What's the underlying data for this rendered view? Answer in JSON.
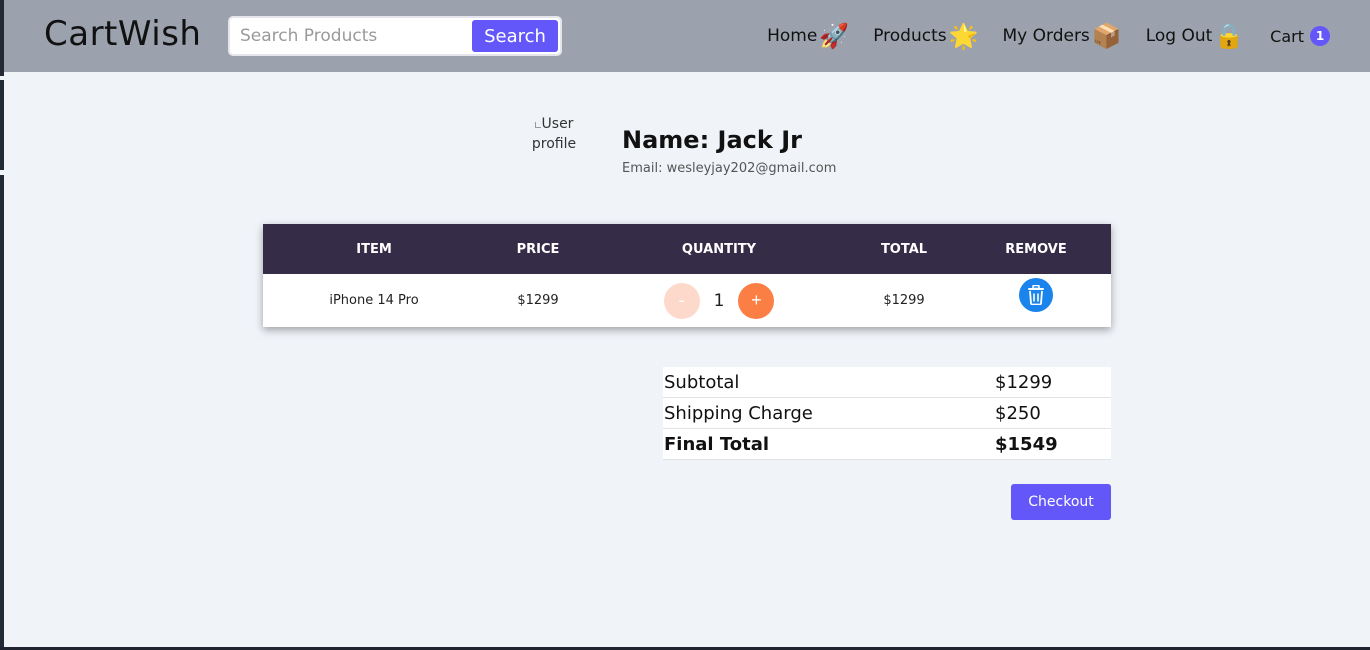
{
  "brand": "CartWish",
  "search": {
    "placeholder": "Search Products",
    "button_label": "Search"
  },
  "nav": {
    "home": "Home",
    "home_icon": "🚀",
    "products": "Products",
    "products_icon": "🌟",
    "orders": "My Orders",
    "orders_icon": "📦",
    "logout": "Log Out",
    "logout_icon": "🔒",
    "cart": "Cart",
    "cart_count": "1"
  },
  "profile": {
    "avatar_alt": "User profile",
    "name": "Name: Jack Jr",
    "email": "Email: wesleyjay202@gmail.com"
  },
  "table": {
    "headers": [
      "ITEM",
      "PRICE",
      "QUANTITY",
      "TOTAL",
      "REMOVE"
    ],
    "rows": [
      {
        "item": "iPhone 14 Pro",
        "price": "$1299",
        "quantity": "1",
        "total": "$1299",
        "minus": "-",
        "plus": "+"
      }
    ]
  },
  "summary": {
    "subtotal_label": "Subtotal",
    "subtotal_value": "$1299",
    "shipping_label": "Shipping Charge",
    "shipping_value": "$250",
    "final_label": "Final Total",
    "final_value": "$1549"
  },
  "checkout_label": "Checkout",
  "colors": {
    "navbar": "#9ba2ae",
    "accent": "#6457f9",
    "table_header": "#352c48",
    "plus_button": "#fb7f45",
    "minus_button": "#fdd9cc",
    "trash_button": "#1a84ec",
    "page_bg": "#f0f4f9"
  },
  "icons": {
    "trash": "trash-icon",
    "broken_image": "broken-image-icon"
  }
}
